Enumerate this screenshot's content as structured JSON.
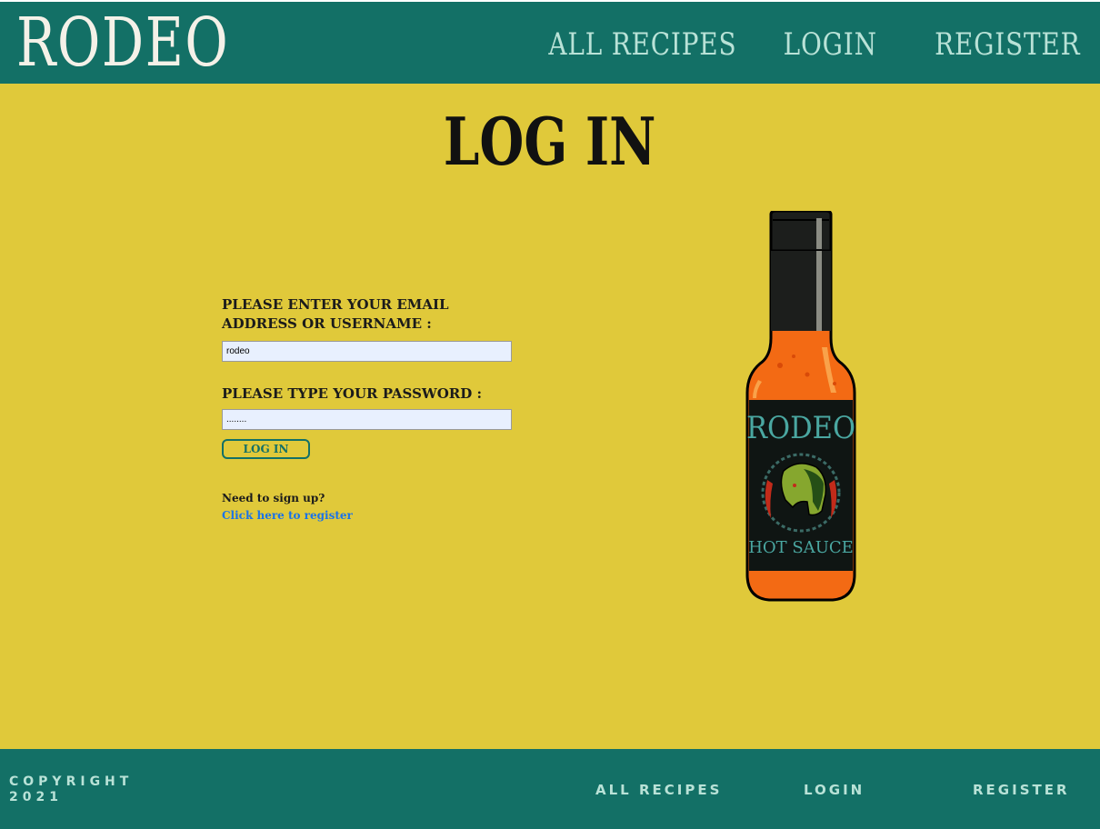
{
  "header": {
    "logo": "RODEO",
    "nav": [
      "ALL RECIPES",
      "LOGIN",
      "REGISTER"
    ]
  },
  "main": {
    "title": "LOG IN",
    "email_label": "PLEASE ENTER YOUR EMAIL ADDRESS OR USERNAME :",
    "email_value": "rodeo",
    "password_label": "PLEASE TYPE YOUR PASSWORD :",
    "password_value": "........",
    "login_button": "LOG IN",
    "signup_prompt": "Need to sign up?",
    "register_link": "Click here to register"
  },
  "bottle": {
    "brand": "RODEO",
    "product": "HOT SAUCE"
  },
  "footer": {
    "copyright": "COPYRIGHT 2021",
    "links": [
      "ALL RECIPES",
      "LOGIN",
      "REGISTER"
    ]
  },
  "colors": {
    "teal": "#137066",
    "mustard": "#e0c93a",
    "mint": "#b9e2d7",
    "link_blue": "#1a73e8"
  }
}
